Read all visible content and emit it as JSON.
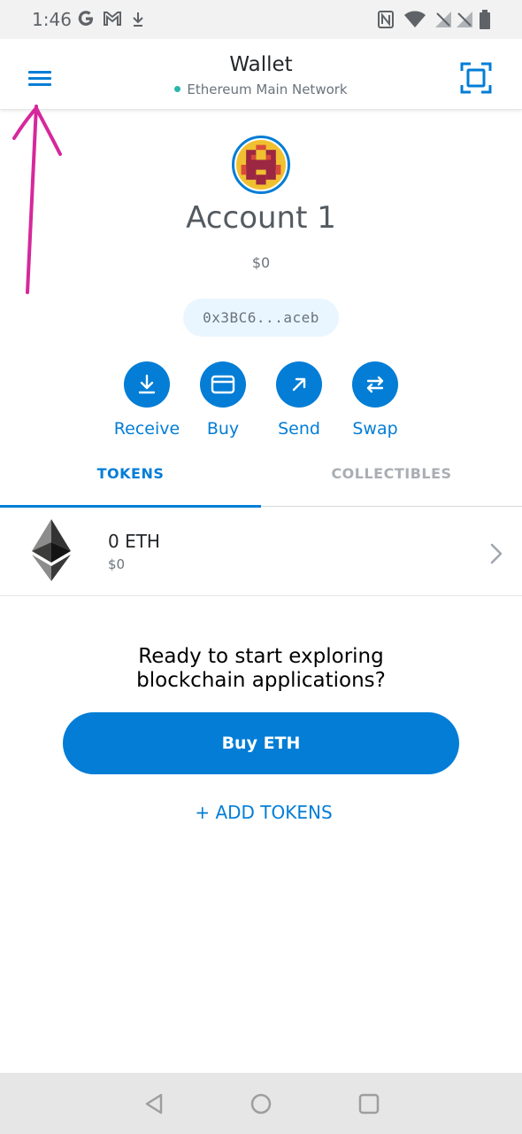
{
  "status_bar": {
    "time": "1:46",
    "left_icons": [
      "google-icon",
      "gmail-icon",
      "download-arrow-icon"
    ],
    "right_icons": [
      "nfc-icon",
      "wifi-icon",
      "signal-icon",
      "signal-icon",
      "battery-icon"
    ]
  },
  "header": {
    "title": "Wallet",
    "network": "Ethereum Main Network",
    "network_dot_color": "#29b6af",
    "menu_icon": "hamburger-menu-icon",
    "scan_icon": "scan-qr-icon"
  },
  "account": {
    "name": "Account 1",
    "balance": "$0",
    "address": "0x3BC6...aceb"
  },
  "actions": [
    {
      "label": "Receive",
      "icon": "receive-icon"
    },
    {
      "label": "Buy",
      "icon": "card-icon"
    },
    {
      "label": "Send",
      "icon": "send-arrow-icon"
    },
    {
      "label": "Swap",
      "icon": "swap-icon"
    }
  ],
  "tabs": [
    {
      "label": "TOKENS",
      "active": true
    },
    {
      "label": "COLLECTIBLES",
      "active": false
    }
  ],
  "tokens": [
    {
      "amount": "0 ETH",
      "fiat": "$0",
      "icon": "ethereum-icon"
    }
  ],
  "empty_state": {
    "line1": "Ready to start exploring",
    "line2": "blockchain applications?",
    "buy_button": "Buy ETH",
    "add_tokens": "+ ADD TOKENS"
  },
  "colors": {
    "accent": "#037dd6",
    "annotation": "#d6289b"
  }
}
